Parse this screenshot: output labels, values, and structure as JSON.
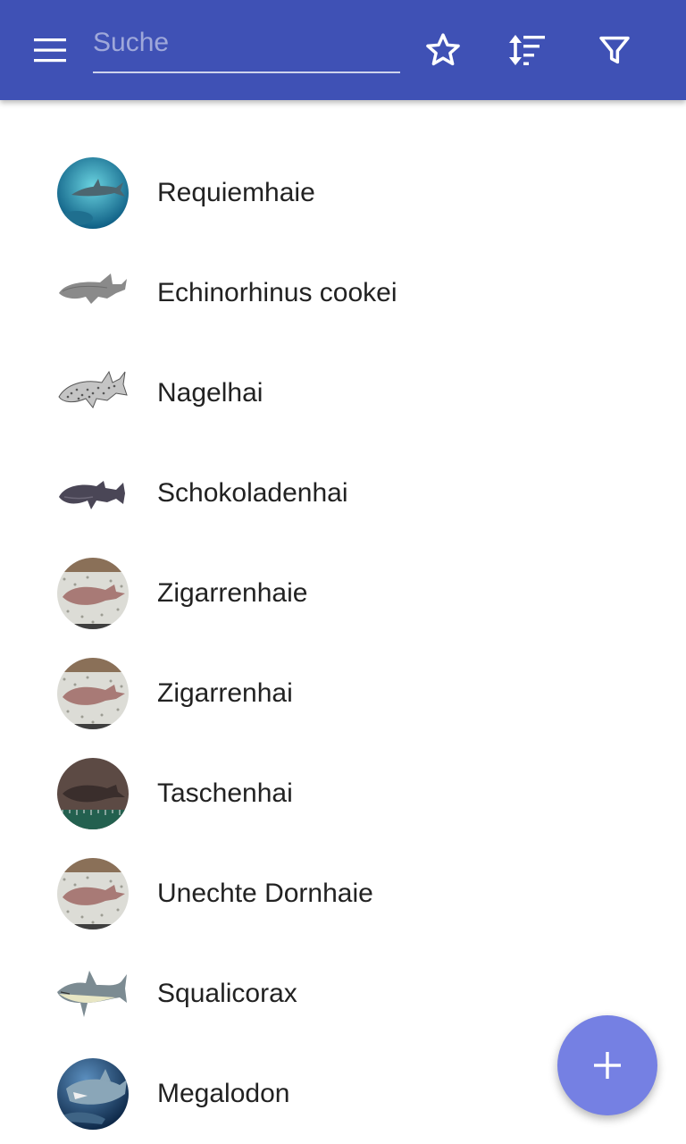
{
  "toolbar": {
    "search_placeholder": "Suche",
    "search_value": "",
    "icons": {
      "menu": "menu-icon",
      "favorites": "star-outline-icon",
      "sort": "sort-icon",
      "filter": "filter-icon"
    }
  },
  "list": {
    "items": [
      {
        "label": "Requiemhaie",
        "thumbnail": "reef-shark-photo"
      },
      {
        "label": "Echinorhinus cookei",
        "thumbnail": "grey-shark-drawing"
      },
      {
        "label": "Nagelhai",
        "thumbnail": "spotted-shark-drawing"
      },
      {
        "label": "Schokoladenhai",
        "thumbnail": "dark-shark-photo"
      },
      {
        "label": "Zigarrenhaie",
        "thumbnail": "cigar-shark-photo"
      },
      {
        "label": "Zigarrenhai",
        "thumbnail": "cigar-shark-photo"
      },
      {
        "label": "Taschenhai",
        "thumbnail": "pocket-shark-photo"
      },
      {
        "label": "Unechte Dornhaie",
        "thumbnail": "cigar-shark-photo"
      },
      {
        "label": "Squalicorax",
        "thumbnail": "squalicorax-illustration"
      },
      {
        "label": "Megalodon",
        "thumbnail": "megalodon-illustration"
      }
    ]
  },
  "fab": {
    "icon": "add-icon"
  },
  "colors": {
    "app_bar": "#3f51b5",
    "placeholder": "#9fa8da",
    "fab": "#7580e3",
    "text": "#222222"
  }
}
